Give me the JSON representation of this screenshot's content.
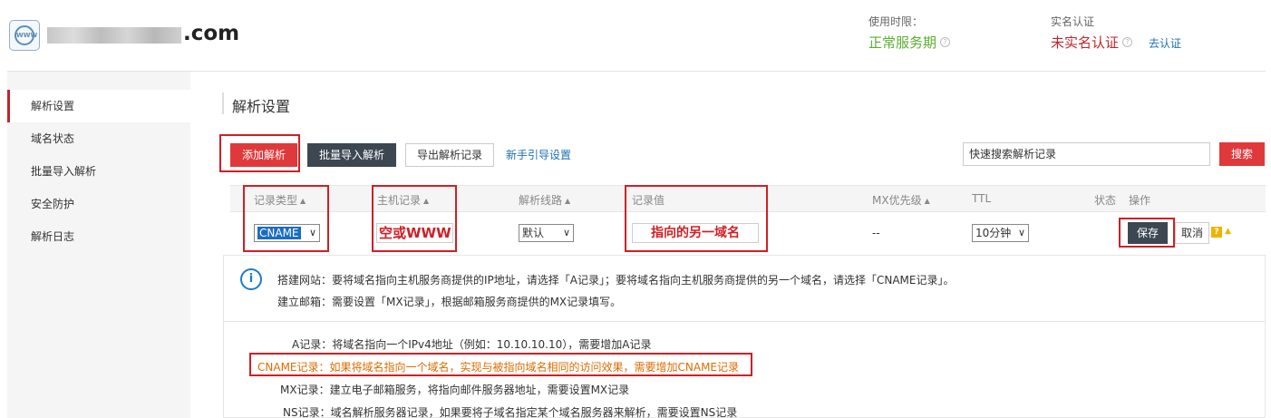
{
  "header": {
    "domain_suffix": ".com",
    "service_label": "使用时限：",
    "service_status": "正常服务期",
    "realname_label": "实名认证",
    "realname_status": "未实名认证",
    "verify_link": "去认证",
    "logo_text": "WWW"
  },
  "sidebar": {
    "items": [
      {
        "label": "解析设置"
      },
      {
        "label": "域名状态"
      },
      {
        "label": "批量导入解析"
      },
      {
        "label": "安全防护"
      },
      {
        "label": "解析日志"
      }
    ]
  },
  "main": {
    "title": "解析设置",
    "toolbar": {
      "add": "添加解析",
      "batch_import": "批量导入解析",
      "export": "导出解析记录",
      "guide": "新手引导设置",
      "search_placeholder": "快速搜索解析记录",
      "search_btn": "搜索"
    },
    "table": {
      "headers": [
        "记录类型",
        "主机记录",
        "解析线路",
        "记录值",
        "MX优先级",
        "TTL",
        "状态",
        "操作"
      ],
      "row": {
        "type": "CNAME",
        "host": "空或WWW",
        "line": "默认",
        "value": "指向的另一域名",
        "mx": "--",
        "ttl": "10分钟",
        "save": "保存",
        "cancel": "取消"
      }
    },
    "info": {
      "website": "搭建网站：要将域名指向主机服务商提供的IP地址，请选择「A记录」；要将域名指向主机服务商提供的另一个域名，请选择「CNAME记录」。",
      "email": "建立邮箱：需要设置「MX记录」，根据邮箱服务商提供的MX记录填写。",
      "records": [
        "A记录：将域名指向一个IPv4地址（例如：10.10.10.10），需要增加A记录",
        "CNAME记录：如果将域名指向一个域名，实现与被指向域名相同的访问效果，需要增加CNAME记录",
        "MX记录：建立电子邮箱服务，将指向邮件服务器地址，需要设置MX记录",
        "NS记录：域名解析服务器记录，如果要将子域名指定某个域名服务器来解析，需要设置NS记录"
      ]
    }
  },
  "colors": {
    "accent_red": "#e0393b",
    "status_green": "#5aae2f",
    "status_red": "#c0262b",
    "link_blue": "#1d6fb5",
    "highlight_red": "#d01f25",
    "cname_orange": "#e06c00"
  }
}
